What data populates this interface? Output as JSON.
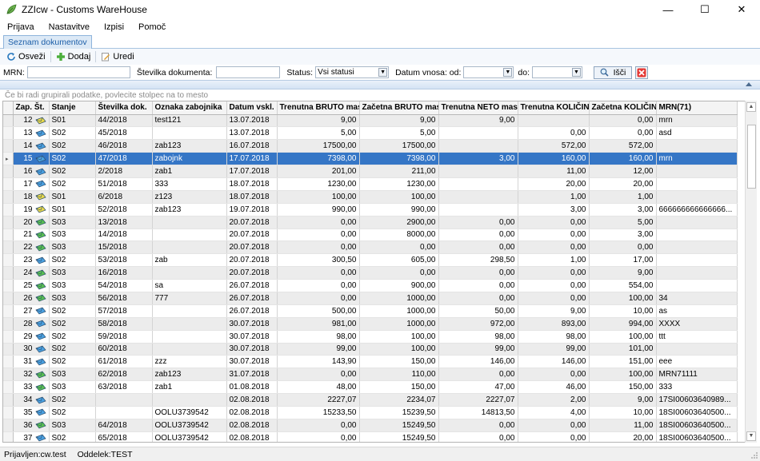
{
  "window": {
    "title": "ZZIcw - Customs WareHouse",
    "minimize": "—",
    "maximize": "☐",
    "close": "✕"
  },
  "menu": [
    "Prijava",
    "Nastavitve",
    "Izpisi",
    "Pomoč"
  ],
  "tab": {
    "label": "Seznam dokumentov"
  },
  "toolbar": {
    "refresh": "Osveži",
    "add": "Dodaj",
    "edit": "Uredi"
  },
  "filters": {
    "mrn_label": "MRN:",
    "docnum_label": "Številka dokumenta:",
    "status_label": "Status:",
    "status_value": "Vsi statusi",
    "date_from_label": "Datum vnosa: od:",
    "date_to_label": "do:",
    "search_button": "Išči"
  },
  "group_hint": "Če bi radi grupirali podatke, povlecite stolpec na to mesto",
  "grid": {
    "columns": [
      "Zap. Št.",
      "Stanje",
      "Številka dok.",
      "Oznaka zabojnika",
      "Datum vskl.",
      "Trenutna BRUTO masa",
      "Začetna BRUTO masa",
      "Trenutna NETO masa",
      "Trenutna KOLIČINA",
      "Začetna KOLIČINA",
      "MRN(71)"
    ],
    "selected_row": 3,
    "rows": [
      [
        "12",
        "S01",
        "44/2018",
        "test121",
        "13.07.2018",
        "9,00",
        "9,00",
        "9,00",
        "",
        "0,00",
        "mrn"
      ],
      [
        "13",
        "S02",
        "45/2018",
        "",
        "13.07.2018",
        "5,00",
        "5,00",
        "",
        "0,00",
        "0,00",
        "asd"
      ],
      [
        "14",
        "S02",
        "46/2018",
        "zab123",
        "16.07.2018",
        "17500,00",
        "17500,00",
        "",
        "572,00",
        "572,00",
        ""
      ],
      [
        "15",
        "S02",
        "47/2018",
        "zabojnk",
        "17.07.2018",
        "7398,00",
        "7398,00",
        "3,00",
        "160,00",
        "160,00",
        "mrn"
      ],
      [
        "16",
        "S02",
        "2/2018",
        "zab1",
        "17.07.2018",
        "201,00",
        "211,00",
        "",
        "11,00",
        "12,00",
        ""
      ],
      [
        "17",
        "S02",
        "51/2018",
        "333",
        "18.07.2018",
        "1230,00",
        "1230,00",
        "",
        "20,00",
        "20,00",
        ""
      ],
      [
        "18",
        "S01",
        "6/2018",
        "z123",
        "18.07.2018",
        "100,00",
        "100,00",
        "",
        "1,00",
        "1,00",
        ""
      ],
      [
        "19",
        "S01",
        "52/2018",
        "zab123",
        "19.07.2018",
        "990,00",
        "990,00",
        "",
        "3,00",
        "3,00",
        "666666666666666..."
      ],
      [
        "20",
        "S03",
        "13/2018",
        "",
        "20.07.2018",
        "0,00",
        "2900,00",
        "0,00",
        "0,00",
        "5,00",
        ""
      ],
      [
        "21",
        "S03",
        "14/2018",
        "",
        "20.07.2018",
        "0,00",
        "8000,00",
        "0,00",
        "0,00",
        "3,00",
        ""
      ],
      [
        "22",
        "S03",
        "15/2018",
        "",
        "20.07.2018",
        "0,00",
        "0,00",
        "0,00",
        "0,00",
        "0,00",
        ""
      ],
      [
        "23",
        "S02",
        "53/2018",
        "zab",
        "20.07.2018",
        "300,50",
        "605,00",
        "298,50",
        "1,00",
        "17,00",
        ""
      ],
      [
        "24",
        "S03",
        "16/2018",
        "",
        "20.07.2018",
        "0,00",
        "0,00",
        "0,00",
        "0,00",
        "9,00",
        ""
      ],
      [
        "25",
        "S03",
        "54/2018",
        "sa",
        "26.07.2018",
        "0,00",
        "900,00",
        "0,00",
        "0,00",
        "554,00",
        ""
      ],
      [
        "26",
        "S03",
        "56/2018",
        "777",
        "26.07.2018",
        "0,00",
        "1000,00",
        "0,00",
        "0,00",
        "100,00",
        "34"
      ],
      [
        "27",
        "S02",
        "57/2018",
        "",
        "26.07.2018",
        "500,00",
        "1000,00",
        "50,00",
        "9,00",
        "10,00",
        "as"
      ],
      [
        "28",
        "S02",
        "58/2018",
        "",
        "30.07.2018",
        "981,00",
        "1000,00",
        "972,00",
        "893,00",
        "994,00",
        "XXXX"
      ],
      [
        "29",
        "S02",
        "59/2018",
        "",
        "30.07.2018",
        "98,00",
        "100,00",
        "98,00",
        "98,00",
        "100,00",
        "ttt"
      ],
      [
        "30",
        "S02",
        "60/2018",
        "",
        "30.07.2018",
        "99,00",
        "100,00",
        "99,00",
        "99,00",
        "101,00",
        ""
      ],
      [
        "31",
        "S02",
        "61/2018",
        "zzz",
        "30.07.2018",
        "143,90",
        "150,00",
        "146,00",
        "146,00",
        "151,00",
        "eee"
      ],
      [
        "32",
        "S03",
        "62/2018",
        "zab123",
        "31.07.2018",
        "0,00",
        "110,00",
        "0,00",
        "0,00",
        "100,00",
        "MRN71111"
      ],
      [
        "33",
        "S03",
        "63/2018",
        "zab1",
        "01.08.2018",
        "48,00",
        "150,00",
        "47,00",
        "46,00",
        "150,00",
        "333"
      ],
      [
        "34",
        "S02",
        "",
        "",
        "02.08.2018",
        "2227,07",
        "2234,07",
        "2227,07",
        "2,00",
        "9,00",
        "17SI00603640989..."
      ],
      [
        "35",
        "S02",
        "",
        "OOLU3739542",
        "02.08.2018",
        "15233,50",
        "15239,50",
        "14813,50",
        "4,00",
        "10,00",
        "18SI00603640500..."
      ],
      [
        "36",
        "S03",
        "64/2018",
        "OOLU3739542",
        "02.08.2018",
        "0,00",
        "15249,50",
        "0,00",
        "0,00",
        "11,00",
        "18SI00603640500..."
      ],
      [
        "37",
        "S02",
        "65/2018",
        "OOLU3739542",
        "02.08.2018",
        "0,00",
        "15249,50",
        "0,00",
        "0,00",
        "20,00",
        "18SI00603640500..."
      ]
    ]
  },
  "status": {
    "user": "Prijavljen:cw.test",
    "department": "Oddelek:TEST"
  },
  "colors": {
    "selection": "#3576c6",
    "accent": "#1c5ea8",
    "alt_row": "#ececec"
  },
  "icons": {
    "row_status": "envelope-icon",
    "refresh": "refresh-icon",
    "add": "plus-icon",
    "edit": "edit-icon",
    "search": "magnifier-icon",
    "clear": "red-x-icon"
  }
}
